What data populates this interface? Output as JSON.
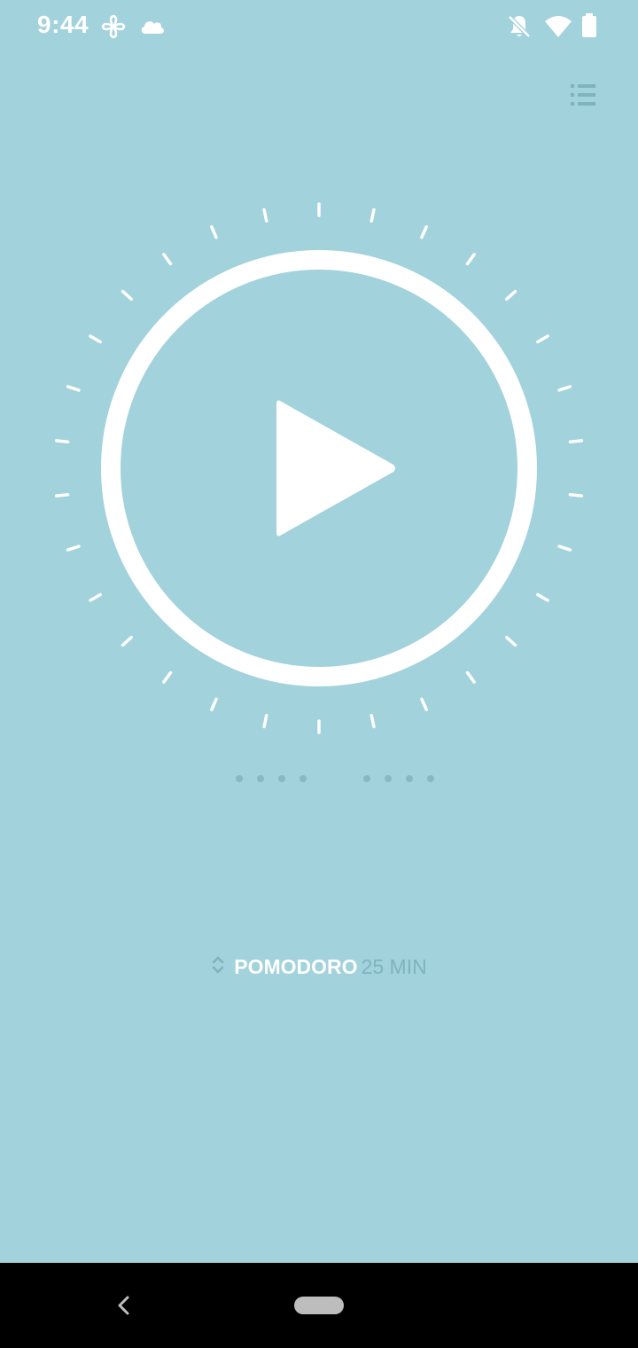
{
  "status_bar": {
    "time": "9:44",
    "icons": [
      "fan-icon",
      "cloud-icon",
      "notifications-off-icon",
      "wifi-icon",
      "battery-icon"
    ]
  },
  "header": {
    "menu_icon": "list-icon"
  },
  "timer": {
    "play_icon": "play-icon",
    "tick_count": 30,
    "pager_left_dots": 4,
    "pager_right_dots": 4
  },
  "mode": {
    "name": "POMODORO",
    "duration": "25 MIN"
  },
  "nav_bar": {
    "back_icon": "back-icon",
    "home_icon": "home-pill-icon"
  },
  "colors": {
    "background": "#a2d2db",
    "foreground": "#ffffff",
    "muted": "#7fb3be",
    "nav": "#000000"
  }
}
